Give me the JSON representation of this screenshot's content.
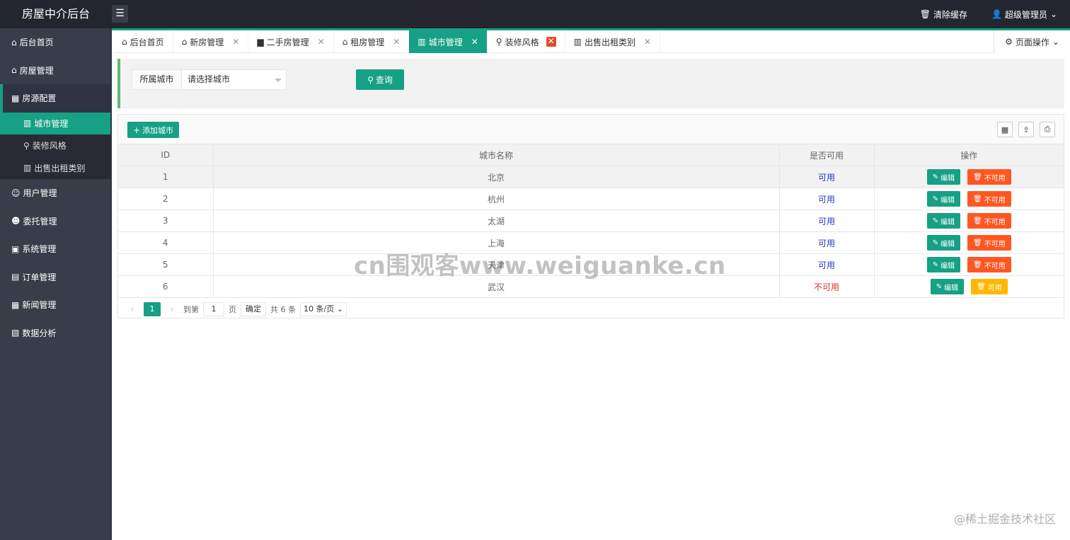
{
  "header": {
    "logo": "房屋中介后台",
    "menu_toggle_icon": "hamburger-icon",
    "clear_cache": "清除缓存",
    "user": "超级管理员"
  },
  "sidebar": {
    "items": [
      {
        "label": "后台首页",
        "icon": "home-icon"
      },
      {
        "label": "房屋管理",
        "icon": "house-icon"
      },
      {
        "label": "房源配置",
        "icon": "building-icon",
        "expanded": true
      },
      {
        "label": "用户管理",
        "icon": "user-icon"
      },
      {
        "label": "委托管理",
        "icon": "delegate-icon"
      },
      {
        "label": "系统管理",
        "icon": "system-icon"
      },
      {
        "label": "订单管理",
        "icon": "order-icon"
      },
      {
        "label": "新闻管理",
        "icon": "news-icon"
      },
      {
        "label": "数据分析",
        "icon": "chart-icon"
      }
    ],
    "sub_items": [
      {
        "label": "城市管理",
        "active": true
      },
      {
        "label": "装修风格",
        "active": false
      },
      {
        "label": "出售出租类别",
        "active": false
      }
    ]
  },
  "tabs": [
    {
      "label": "后台首页",
      "closable": false
    },
    {
      "label": "新房管理",
      "closable": true
    },
    {
      "label": "二手房管理",
      "closable": true
    },
    {
      "label": "租房管理",
      "closable": true
    },
    {
      "label": "城市管理",
      "closable": true,
      "active": true
    },
    {
      "label": "装修风格",
      "closable": true,
      "hover": true
    },
    {
      "label": "出售出租类别",
      "closable": true
    }
  ],
  "page_ops": "页面操作",
  "search": {
    "label": "所属城市",
    "placeholder": "请选择城市",
    "button": "查询"
  },
  "toolbar": {
    "add_button": "添加城市"
  },
  "table": {
    "columns": [
      "ID",
      "城市名称",
      "是否可用",
      "操作"
    ],
    "rows": [
      {
        "id": "1",
        "name": "北京",
        "status": "可用",
        "enabled": true
      },
      {
        "id": "2",
        "name": "杭州",
        "status": "可用",
        "enabled": true
      },
      {
        "id": "3",
        "name": "太湖",
        "status": "可用",
        "enabled": true
      },
      {
        "id": "4",
        "name": "上海",
        "status": "可用",
        "enabled": true
      },
      {
        "id": "5",
        "name": "天津",
        "status": "可用",
        "enabled": true
      },
      {
        "id": "6",
        "name": "武汉",
        "status": "不可用",
        "enabled": false
      }
    ],
    "edit_label": "编辑",
    "disable_label": "不可用",
    "enable_label": "可用"
  },
  "pager": {
    "current": "1",
    "goto_prefix": "到第",
    "goto_value": "1",
    "goto_suffix": "页",
    "confirm": "确定",
    "total": "共 6 条",
    "page_size": "10 条/页"
  },
  "watermark": "cn围观客www.weiguanke.cn",
  "corner_mark": "@稀土掘金技术社区",
  "colors": {
    "accent": "#16a085",
    "header_bg": "#23262e",
    "sidebar_bg": "#393d49",
    "danger": "#ff5722",
    "warn": "#ffb800"
  }
}
